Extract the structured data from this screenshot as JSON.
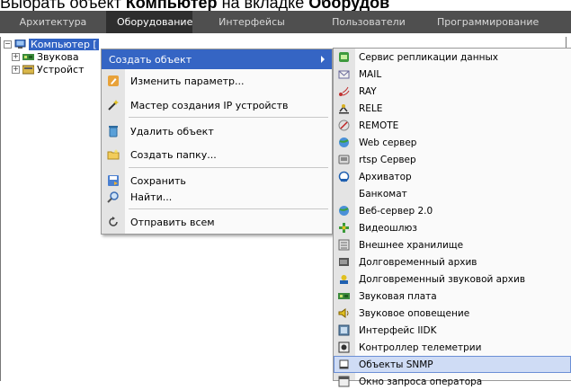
{
  "doc_title": {
    "before": "Выбрать объект ",
    "bold1": "Компьютер",
    "middle": " на вкладке ",
    "bold2": "Оборудов"
  },
  "tabs": [
    "Архитектура",
    "Оборудование",
    "Интерфейсы",
    "Пользователи",
    "Программирование"
  ],
  "active_tab": "Оборудование",
  "tree": {
    "root_label": "Компьютер [",
    "child1_label": "Звукова",
    "child2_label": "Устройст"
  },
  "context_menu": {
    "create_object": "Создать объект",
    "change_param": "Изменить параметр...",
    "ip_wizard": "Мастер создания IP устройств",
    "delete_object": "Удалить объект",
    "create_folder": "Создать папку...",
    "save": "Сохранить",
    "find": "Найти...",
    "send_all": "Отправить всем"
  },
  "submenu": [
    "Сервис репликации данных",
    "MAIL",
    "RAY",
    "RELE",
    "REMOTE",
    "Web сервер",
    "rtsp Сервер",
    "Архиватор",
    "Банкомат",
    "Веб-сервер 2.0",
    "Видеошлюз",
    "Внешнее хранилище",
    "Долговременный архив",
    "Долговременный звуковой архив",
    "Звуковая плата",
    "Звуковое оповещение",
    "Интерфейс IIDK",
    "Контроллер телеметрии",
    "Объекты SNMP",
    "Окно запроса оператора"
  ],
  "highlight_color": "#3565c4",
  "hover_item": "Объекты SNMP"
}
